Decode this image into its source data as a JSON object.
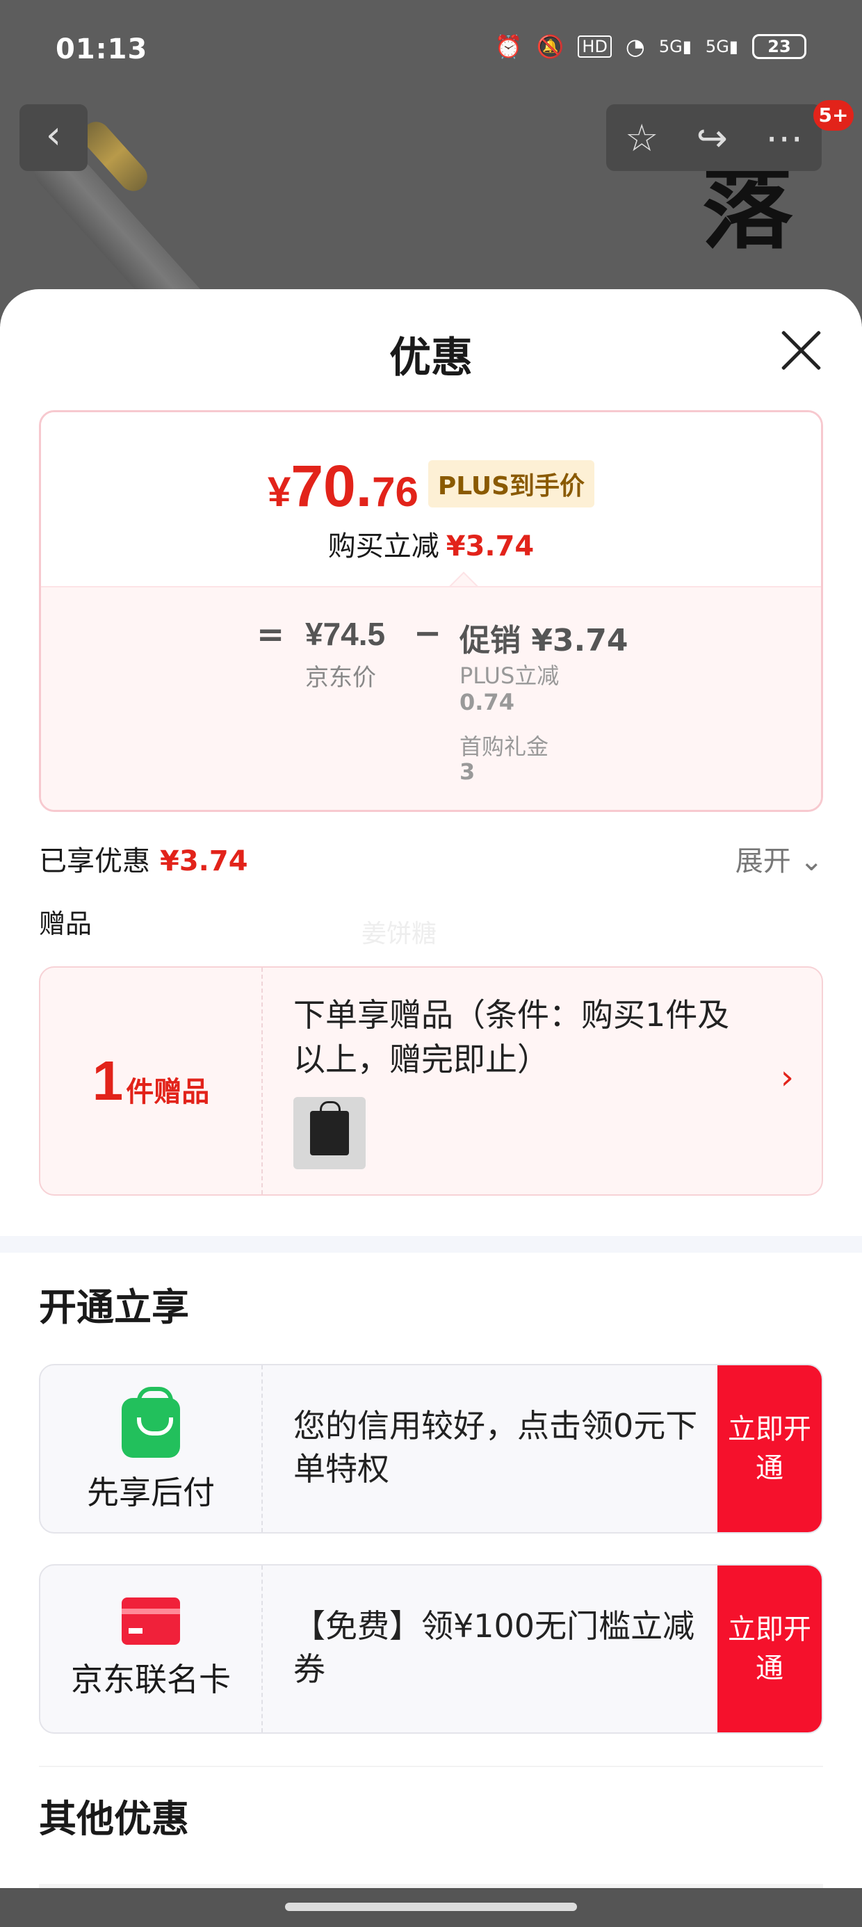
{
  "status_bar": {
    "time": "01:13",
    "battery": "23",
    "icons": [
      "alarm-icon",
      "mute-icon",
      "hd-icon",
      "wifi-icon",
      "5g-signal-icon",
      "5g-signal-icon-2"
    ]
  },
  "nav": {
    "back_glyph": "‹",
    "favorite_glyph": "☆",
    "share_glyph": "↪",
    "more_glyph": "⋯",
    "badge": "5+"
  },
  "background": {
    "calligraphy": "落"
  },
  "sheet": {
    "title": "优惠",
    "price_card": {
      "currency": "¥",
      "price_int": "70.",
      "price_dec": "76",
      "plus_tag": "PLUS到手价",
      "sub_label": "购买立减",
      "sub_value": "¥3.74",
      "equals": "=",
      "jd_price": "¥74.5",
      "jd_label": "京东价",
      "minus": "−",
      "promo": "促销 ¥3.74",
      "promo_items": [
        {
          "label": "PLUS立减",
          "value": "0.74"
        },
        {
          "label": "首购礼金",
          "value": "3"
        }
      ]
    },
    "enjoyed": {
      "label": "已享优惠",
      "value": "¥3.74",
      "expand": "展开 ⌄"
    },
    "gift": {
      "section_label": "赠品",
      "watermark": "姜饼糖",
      "count": "1",
      "unit": "件赠品",
      "text": "下单享赠品（条件：购买1件及以上，赠完即止）",
      "arrow": "›"
    },
    "open_section": {
      "title": "开通立享",
      "offers": [
        {
          "name": "先享后付",
          "text": "您的信用较好，点击领0元下单特权",
          "button": "立即开通"
        },
        {
          "name": "京东联名卡",
          "text": "【免费】领¥100无门槛立减券",
          "button": "立即开通"
        }
      ]
    },
    "other_title": "其他优惠"
  },
  "colors": {
    "accent_red": "#e2231a",
    "button_red": "#f5112c",
    "plus_gold": "#8a5a00",
    "green": "#22c05c"
  }
}
